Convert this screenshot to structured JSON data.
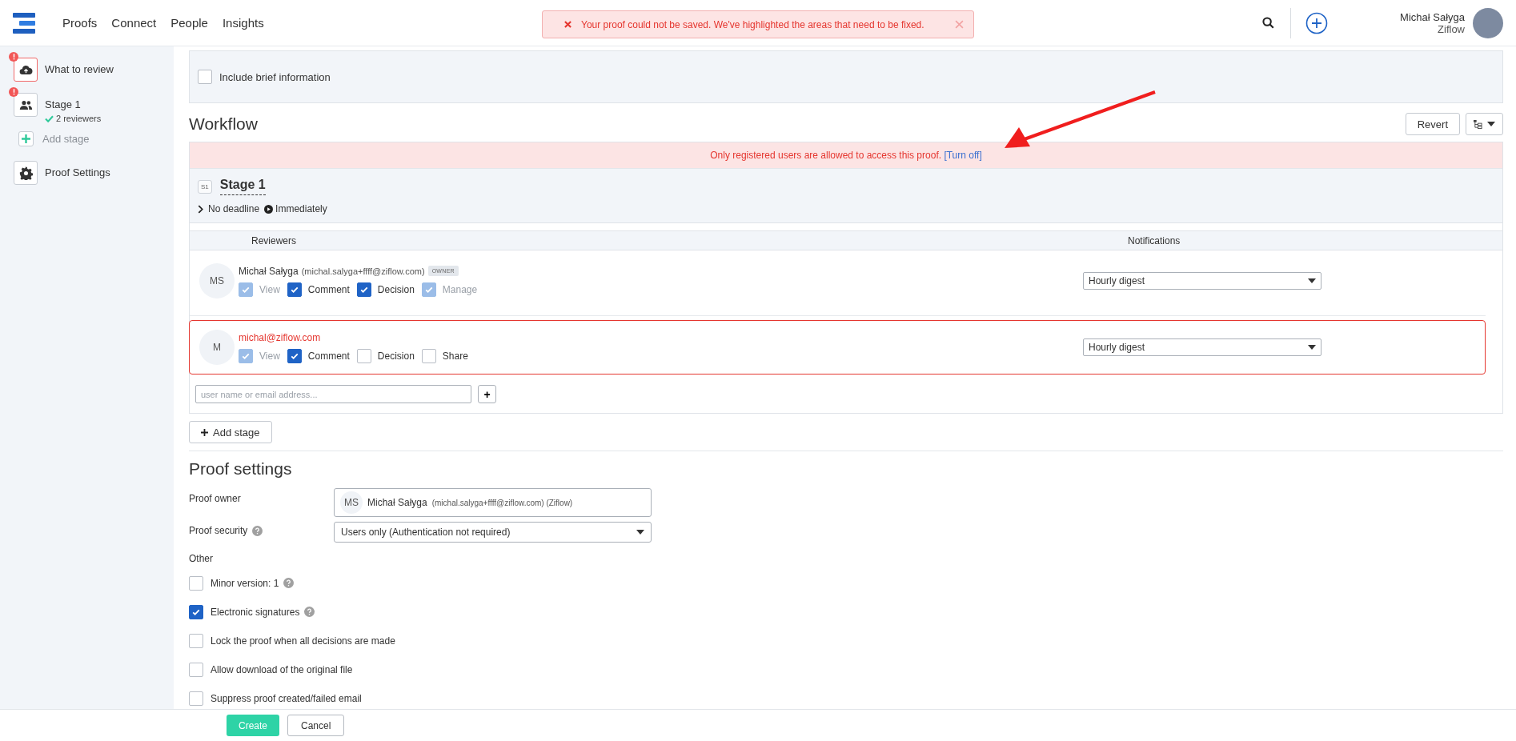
{
  "nav": {
    "links": [
      {
        "label": "Proofs"
      },
      {
        "label": "Connect"
      },
      {
        "label": "People"
      },
      {
        "label": "Insights"
      }
    ]
  },
  "error_toast": {
    "message": "Your proof could not be saved. We've highlighted the areas that need to be fixed."
  },
  "user": {
    "name": "Michał Sałyga",
    "org": "Ziflow"
  },
  "sidebar": {
    "items": [
      {
        "kind": "step",
        "label": "What to review",
        "error": true,
        "selected": true
      },
      {
        "kind": "step",
        "label": "Stage 1",
        "sublabel": "2 reviewers",
        "error": true,
        "selected": false
      },
      {
        "kind": "add",
        "label": "Add stage"
      },
      {
        "kind": "step",
        "label": "Proof Settings",
        "error": false,
        "selected": false
      }
    ]
  },
  "brief": {
    "label": "Include brief information",
    "checked": false
  },
  "workflow": {
    "title": "Workflow",
    "revert": "Revert",
    "banner": {
      "message": "Only registered users are allowed to access this proof.",
      "link": "[Turn off]"
    },
    "stage": {
      "badge": "S1",
      "name": "Stage 1",
      "deadline": "No deadline",
      "start": "Immediately"
    },
    "columns": [
      "Reviewers",
      "Notifications"
    ],
    "reviewers": [
      {
        "initials": "MS",
        "name": "Michał Sałyga",
        "email": "(michal.salyga+ffff@ziflow.com)",
        "tag": "OWNER",
        "error": false,
        "notification": "Hourly digest",
        "permissions": [
          {
            "label": "View",
            "checked": true,
            "disabled": true
          },
          {
            "label": "Comment",
            "checked": true,
            "disabled": false
          },
          {
            "label": "Decision",
            "checked": true,
            "disabled": false
          },
          {
            "label": "Manage",
            "checked": true,
            "disabled": true
          }
        ]
      },
      {
        "initials": "M",
        "name": "michal@ziflow.com",
        "error": true,
        "notification": "Hourly digest",
        "permissions": [
          {
            "label": "View",
            "checked": true,
            "disabled": true
          },
          {
            "label": "Comment",
            "checked": true,
            "disabled": false
          },
          {
            "label": "Decision",
            "checked": false,
            "disabled": false
          },
          {
            "label": "Share",
            "checked": false,
            "disabled": false
          }
        ]
      }
    ],
    "add_placeholder": "user name or email address...",
    "add_button": "+",
    "add_stage": "Add stage"
  },
  "proof_settings": {
    "title": "Proof settings",
    "owner_label": "Proof owner",
    "owner": {
      "initials": "MS",
      "name": "Michał Sałyga",
      "detail": "(michal.salyga+ffff@ziflow.com) (Ziflow)"
    },
    "security_label": "Proof security",
    "security_help": true,
    "security": "Users only (Authentication not required)",
    "other_label": "Other",
    "options": [
      {
        "label": "Minor version: 1",
        "help": true,
        "checked": false
      },
      {
        "label": "Electronic signatures",
        "help": true,
        "checked": true
      },
      {
        "label": "Lock the proof when all decisions are made",
        "help": false,
        "checked": false
      },
      {
        "label": "Allow download of the original file",
        "help": false,
        "checked": false
      },
      {
        "label": "Suppress proof created/failed email",
        "help": false,
        "checked": false
      }
    ]
  },
  "footer": {
    "create": "Create",
    "cancel": "Cancel"
  }
}
